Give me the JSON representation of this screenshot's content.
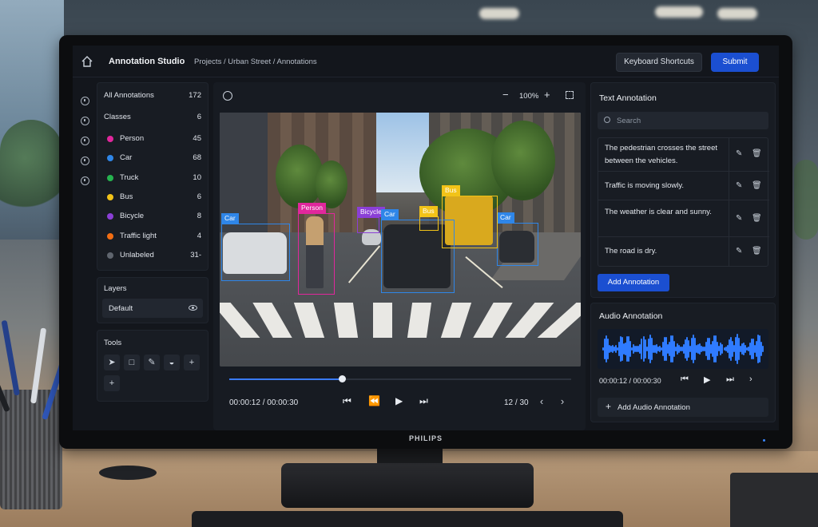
{
  "monitor": {
    "brand": "PHILIPS"
  },
  "header": {
    "title": "Annotation Studio",
    "breadcrumb": "Projects / Urban Street / Annotations",
    "shortcuts_label": "Keyboard Shortcuts",
    "submit_label": "Submit"
  },
  "classes_panel": {
    "all_label": "All Annotations",
    "all_count": "172",
    "classes_label": "Classes",
    "classes_count": "6",
    "items": [
      {
        "label": "Person",
        "count": "45",
        "color": "#e0279c"
      },
      {
        "label": "Car",
        "count": "68",
        "color": "#2f86e8"
      },
      {
        "label": "Truck",
        "count": "10",
        "color": "#26b34f"
      },
      {
        "label": "Bus",
        "count": "6",
        "color": "#f2c318"
      },
      {
        "label": "Bicycle",
        "count": "8",
        "color": "#8b3fd6"
      },
      {
        "label": "Traffic light",
        "count": "4",
        "color": "#f26d12"
      },
      {
        "label": "Unlabeled",
        "count": "31-",
        "color": "#5f656e"
      }
    ]
  },
  "layers": {
    "title": "Layers",
    "default_label": "Default"
  },
  "tools": {
    "title": "Tools",
    "icons": [
      "pointer-icon",
      "rectangle-icon",
      "pen-icon",
      "polygon-icon",
      "crosshair-icon",
      "add-icon"
    ]
  },
  "viewer": {
    "zoom": "100%",
    "boxes": [
      {
        "label": "Car",
        "color": "#2f86e8"
      },
      {
        "label": "Person",
        "color": "#e0279c"
      },
      {
        "label": "Bicycle",
        "color": "#8b3fd6"
      },
      {
        "label": "Car",
        "color": "#2f86e8"
      },
      {
        "label": "Bus",
        "color": "#f2c318"
      },
      {
        "label": "Car",
        "color": "#2f86e8"
      },
      {
        "label": "Bus",
        "color": "#f2c318"
      }
    ],
    "time": "00:00:12 / 00:00:30",
    "progress": 0.33,
    "frames": "12 / 30"
  },
  "text_annotation": {
    "title": "Text Annotation",
    "search_placeholder": "Search",
    "items": [
      "The pedestrian crosses the street between the vehicles.",
      "Traffic is moving slowly.",
      "The weather is clear and sunny.",
      "The road is dry."
    ],
    "add_label": "Add Annotation"
  },
  "audio_annotation": {
    "title": "Audio Annotation",
    "time": "00:00:12 / 00:00:30",
    "add_label": "Add Audio Annotation"
  }
}
